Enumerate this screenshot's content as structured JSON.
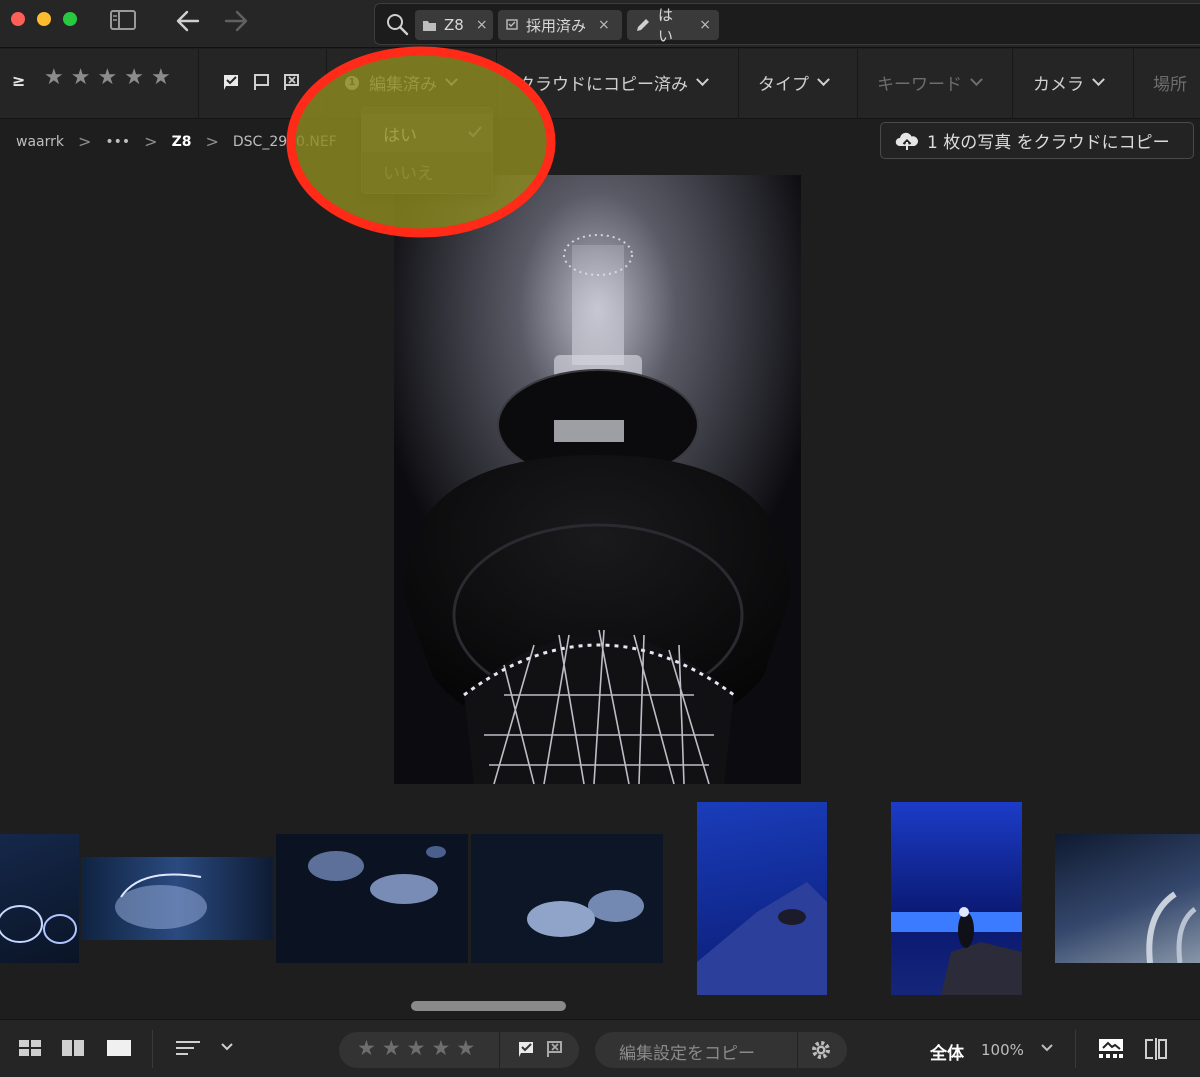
{
  "search": {
    "chips": [
      {
        "label": "Z8",
        "icon": "folder-icon"
      },
      {
        "label": "採用済み",
        "icon": "flag-picked-icon"
      },
      {
        "label": "はい",
        "icon": "pencil-icon"
      }
    ],
    "chip_close": "×"
  },
  "filter": {
    "ge_symbol": "≥",
    "star_glyph": "★",
    "edited_badge": "1",
    "edited_label": "編集済み",
    "cloud_label": "クラウドにコピー済み",
    "type_label": "タイプ",
    "keyword_label": "キーワード",
    "camera_label": "カメラ",
    "place_label": "場所"
  },
  "dropdown": {
    "options": [
      {
        "label": "はい",
        "selected": true
      },
      {
        "label": "いいえ",
        "selected": false
      }
    ]
  },
  "breadcrumb": {
    "root": "waarrk",
    "ellipsis": "•••",
    "folder": "Z8",
    "file": "DSC_2900.NEF",
    "sep": ">"
  },
  "cloud_copy_button": {
    "label": "1 枚の写真 をクラウドにコピー"
  },
  "bottom": {
    "copy_settings_label": "編集設定をコピー",
    "zoom_fit": "全体",
    "zoom_value": "100%"
  },
  "colors": {
    "annotation_ring": "#ff2a17",
    "annotation_fill": "#8c8a1e",
    "background": "#1e1e1e"
  }
}
